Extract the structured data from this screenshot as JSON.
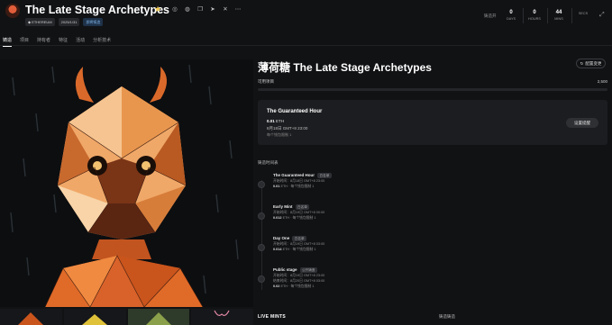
{
  "collection": {
    "title": "The Late Stage Archetypes",
    "chain_chip": "ETHEREUM",
    "date_chip": "2025/1/31",
    "status_chip": "即将铸造"
  },
  "countdown": {
    "label": "铸造开",
    "items": [
      {
        "value": "0",
        "unit": "DAYS"
      },
      {
        "value": "0",
        "unit": "HOURS"
      },
      {
        "value": "44",
        "unit": "MINS"
      },
      {
        "value": "",
        "unit": "SECS"
      }
    ]
  },
  "tabs": [
    {
      "label": "铸造",
      "active": true
    },
    {
      "label": "项目"
    },
    {
      "label": "持有者"
    },
    {
      "label": "特征"
    },
    {
      "label": "活动"
    },
    {
      "label": "分析技术"
    }
  ],
  "main": {
    "title": "薄荷糖 The Late Stage Archetypes",
    "share_label": "配置变更",
    "supply_label": "可用项目",
    "supply_value": "2,500",
    "supply_progress": 0.0
  },
  "current_stage": {
    "title": "The Guaranteed Hour",
    "price": "0.01",
    "currency": "ETH",
    "date": "8月18日 GMT+8 23:00",
    "limit": "每个钱包限制 1",
    "remind_label": "设置提醒"
  },
  "schedule_label": "铸造时间表",
  "stages": [
    {
      "name": "The Guaranteed Hour",
      "badge": "白名单",
      "line1": "开始时间：8月18日 GMT+8 23:00",
      "price": "0.01",
      "currency": "ETH",
      "limit": "每个钱包限制 1"
    },
    {
      "name": "Early Mint",
      "badge": "白名单",
      "line1": "开始时间：8月19日 GMT+8 00:00",
      "price": "0.012",
      "currency": "ETH",
      "limit": "每个钱包限制 1"
    },
    {
      "name": "Day One",
      "badge": "白名单",
      "line1": "开始时间：8月19日 GMT+8 03:00",
      "price": "0.014",
      "currency": "ETH",
      "limit": "每个钱包限制 1"
    },
    {
      "name": "Public stage",
      "badge": "公开铸造",
      "line1": "开始时间：8月19日 GMT+8 23:00",
      "line2": "结束时间：8月20日 GMT+8 03:00",
      "price": "0.02",
      "currency": "ETH",
      "limit": "每个钱包限制 1"
    }
  ],
  "bottom": {
    "live_mints": "LIVE MINTS",
    "recent_label": "铸造铸造"
  },
  "colors": {
    "background": "#111214",
    "card": "#1c1d20",
    "accent_orange": "#e05d2a",
    "star": "#f2c94c"
  }
}
